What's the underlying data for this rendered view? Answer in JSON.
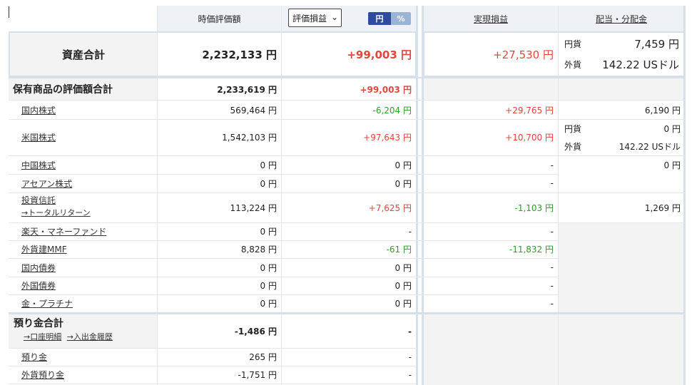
{
  "header": {
    "market_value": "時価評価額",
    "select_value": "評価損益",
    "toggle_yen": "円",
    "toggle_pct": "%",
    "realized": "実現損益",
    "dividends": "配当・分配金"
  },
  "total": {
    "label": "資産合計",
    "market_value": "2,232,133 円",
    "unrealized": "+99,003 円",
    "realized": "+27,530 円",
    "div_jpy_label": "円貨",
    "div_jpy": "7,459 円",
    "div_fx_label": "外貨",
    "div_fx": "142.22 USドル"
  },
  "holdings": {
    "label": "保有商品の評価額合計",
    "market_value": "2,233,619 円",
    "unrealized": "+99,003 円"
  },
  "rows": [
    {
      "label": "国内株式",
      "market_value": "569,464 円",
      "unrealized": "-6,204 円",
      "realized": "+29,765 円",
      "dividend": "6,190 円"
    },
    {
      "label": "米国株式",
      "market_value": "1,542,103 円",
      "unrealized": "+97,643 円",
      "realized": "+10,700 円",
      "div_jpy_label": "円貨",
      "div_jpy": "0 円",
      "div_fx_label": "外貨",
      "div_fx": "142.22 USドル"
    },
    {
      "label": "中国株式",
      "market_value": "0 円",
      "unrealized": "0 円",
      "realized": "-",
      "dividend": "0 円"
    },
    {
      "label": "アセアン株式",
      "market_value": "0 円",
      "unrealized": "0 円",
      "realized": "-"
    },
    {
      "label": "投資信託",
      "sublink": "→トータルリターン",
      "market_value": "113,224 円",
      "unrealized": "+7,625 円",
      "realized": "-1,103 円",
      "dividend": "1,269 円"
    },
    {
      "label": "楽天・マネーファンド",
      "market_value": "0 円",
      "unrealized": "-",
      "realized": "-"
    },
    {
      "label": "外貨建MMF",
      "market_value": "8,828 円",
      "unrealized": "-61 円",
      "realized": "-11,832 円"
    },
    {
      "label": "国内債券",
      "market_value": "0 円",
      "unrealized": "0 円",
      "realized": "-"
    },
    {
      "label": "外国債券",
      "market_value": "0 円",
      "unrealized": "0 円",
      "realized": "-"
    },
    {
      "label": "金・プラチナ",
      "market_value": "0 円",
      "unrealized": "0 円",
      "realized": "-"
    }
  ],
  "deposits": {
    "label": "預り金合計",
    "link1": "→口座明細",
    "link2": "→入出金履歴",
    "market_value": "-1,486 円",
    "unrealized": "-",
    "rows": [
      {
        "label": "預り金",
        "market_value": "265 円",
        "unrealized": "-"
      },
      {
        "label": "外貨預り金",
        "market_value": "-1,751 円",
        "unrealized": "-"
      }
    ]
  }
}
